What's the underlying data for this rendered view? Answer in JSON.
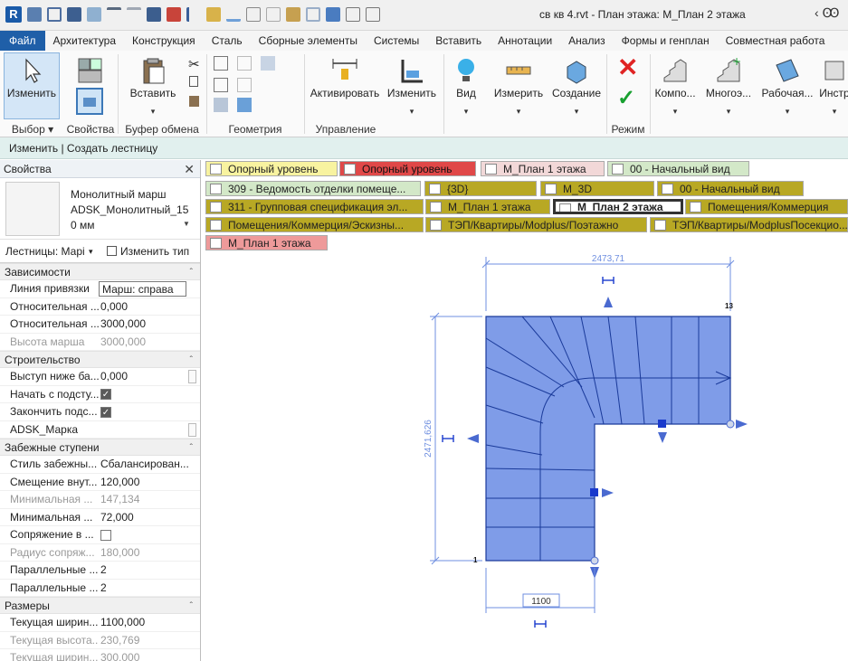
{
  "app": {
    "logo": "R",
    "title": "св кв 4.rvt - План этажа: М_План 2 этажа",
    "title_right": "‹ Ꙭ"
  },
  "ribbon_tabs": [
    "Файл",
    "Архитектура",
    "Конструкция",
    "Сталь",
    "Сборные элементы",
    "Системы",
    "Вставить",
    "Аннотации",
    "Анализ",
    "Формы и генплан",
    "Совместная работа"
  ],
  "ribbon": {
    "modify_label": "Изменить",
    "paste_label": "Вставить",
    "activate_label": "Активировать",
    "modify2_label": "Изменить",
    "view_label": "Вид",
    "measure_label": "Измерить",
    "create_label": "Создание",
    "component_label": "Компо...",
    "multilevel_label": "Многоэ...",
    "workplane_label": "Рабочая...",
    "tools_label": "Инстр",
    "panels": {
      "select": "Выбор ▾",
      "properties": "Свойства",
      "clipboard": "Буфер обмена",
      "geometry": "Геометрия",
      "control": "Управление",
      "mode": "Режим"
    }
  },
  "context_bar": "Изменить | Создать лестницу",
  "properties": {
    "header": "Свойства",
    "close": "✕",
    "type_name_line1": "Монолитный марш",
    "type_name_line2": "ADSK_Монолитный_15",
    "type_name_line3": "0 мм",
    "instance_filter": "Лестницы: Марі",
    "edit_type": "Изменить тип",
    "groups": [
      {
        "title": "Зависимости",
        "rows": [
          {
            "k": "Линия привязки",
            "v": "Марш: справа",
            "boxed": true
          },
          {
            "k": "Относительная ...",
            "v": "0,000"
          },
          {
            "k": "Относительная ...",
            "v": "3000,000"
          },
          {
            "k": "Высота марша",
            "v": "3000,000",
            "dim": true
          }
        ]
      },
      {
        "title": "Строительство",
        "rows": [
          {
            "k": "Выступ ниже ба...",
            "v": "0,000"
          },
          {
            "k": "Начать с подсту...",
            "check": true
          },
          {
            "k": "Закончить подс...",
            "check": true
          },
          {
            "k": "ADSK_Марка",
            "v": ""
          }
        ]
      },
      {
        "title": "Забежные ступени",
        "rows": [
          {
            "k": "Стиль забежны...",
            "v": "Сбалансирован..."
          },
          {
            "k": "Смещение внут...",
            "v": "120,000"
          },
          {
            "k": "Минимальная ...",
            "v": "147,134",
            "dim": true
          },
          {
            "k": "Минимальная ...",
            "v": "72,000"
          },
          {
            "k": "Сопряжение в ...",
            "check": false
          },
          {
            "k": "Радиус сопряж...",
            "v": "180,000",
            "dim": true
          },
          {
            "k": "Параллельные ...",
            "v": "2"
          },
          {
            "k": "Параллельные ...",
            "v": "2"
          }
        ]
      },
      {
        "title": "Размеры",
        "rows": [
          {
            "k": "Текущая ширин...",
            "v": "1100,000"
          },
          {
            "k": "Текущая высота...",
            "v": "230,769",
            "dim": true
          },
          {
            "k": "Текущая ширин...",
            "v": "300,000",
            "dim": true
          }
        ]
      }
    ]
  },
  "view_tabs": [
    {
      "label": "Опорный уровень",
      "style": "yellow"
    },
    {
      "label": "Опорный уровень",
      "style": "red"
    },
    {
      "label": "М_План 1 этажа",
      "style": "pink"
    },
    {
      "label": "00 - Начальный вид",
      "style": "green"
    },
    {
      "label": "309 - Ведомость отделки помеще...",
      "style": "green"
    },
    {
      "label": "{3D}",
      "style": "olive"
    },
    {
      "label": "М_3D",
      "style": "olive"
    },
    {
      "label": "00 - Начальный вид",
      "style": "olive"
    },
    {
      "label": "311 - Групповая спецификация эл...",
      "style": "olive"
    },
    {
      "label": "М_План 1 этажа",
      "style": "olive"
    },
    {
      "label": "М_План 2 этажа",
      "style": "active"
    },
    {
      "label": "Помещения/Коммерция",
      "style": "olive"
    },
    {
      "label": "Помещения/Коммерция/Эскизны...",
      "style": "olive"
    },
    {
      "label": "ТЭП/Квартиры/Modplus/Поэтажно",
      "style": "olive"
    },
    {
      "label": "ТЭП/Квартиры/ModplusПосекцио...",
      "style": "olive"
    },
    {
      "label": "М_План 1 этажа",
      "style": "salmon"
    }
  ],
  "drawing": {
    "dim_top": "2473,71",
    "dim_left": "2471,626",
    "dim_bottom": "1100",
    "label_start": "1",
    "label_end": "13",
    "colors": {
      "stair_fill": "#7f9ce8",
      "stair_line": "#1a3a9a",
      "dim": "#6f8fe0"
    }
  }
}
